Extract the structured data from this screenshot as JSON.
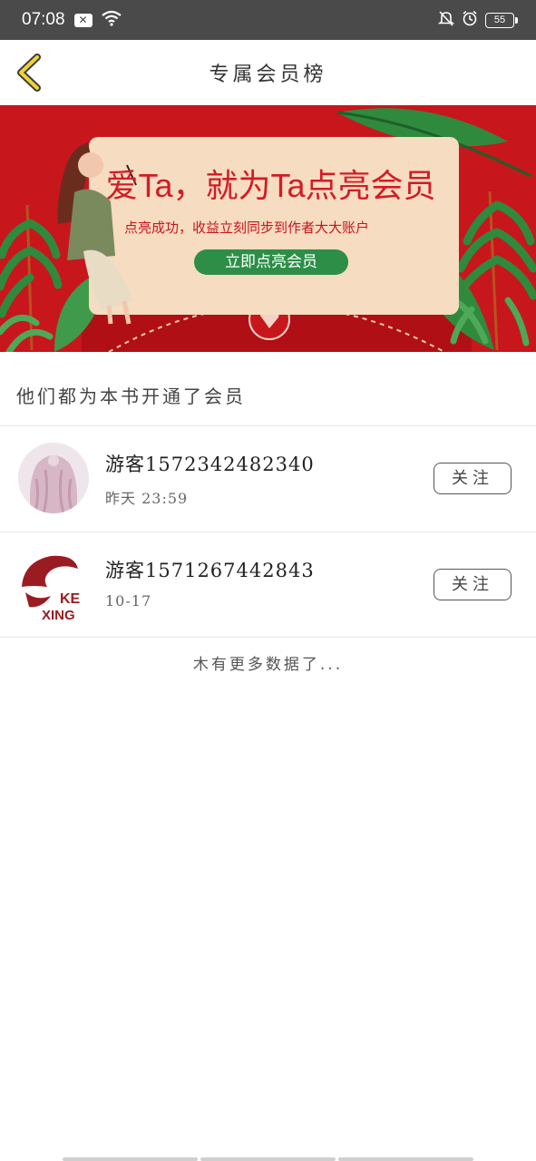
{
  "status_bar": {
    "time": "07:08",
    "battery": "55",
    "icons": [
      "notification-box-icon",
      "wifi-icon",
      "mute-bell-icon",
      "alarm-icon",
      "battery-icon"
    ]
  },
  "header": {
    "title": "专属会员榜",
    "back_icon": "chevron-left-icon"
  },
  "banner": {
    "headline": "爱Ta，就为Ta点亮会员",
    "subtitle": "点亮成功，收益立刻同步到作者大大账户",
    "cta": "立即点亮会员",
    "colors": {
      "background": "#c8161d",
      "card": "#f6dcc1",
      "button": "#2d8f47"
    }
  },
  "section": {
    "title": "他们都为本书开通了会员"
  },
  "members": [
    {
      "name": "游客1572342482340",
      "time": "昨天 23:59",
      "follow_label": "关注",
      "avatar": "girl-avatar"
    },
    {
      "name": "游客1571267442843",
      "time": "10-17",
      "follow_label": "关注",
      "avatar": "kexing-logo-avatar",
      "logo_text_top": "KE",
      "logo_text_bottom": "XING"
    }
  ],
  "footer": {
    "no_more": "木有更多数据了..."
  }
}
